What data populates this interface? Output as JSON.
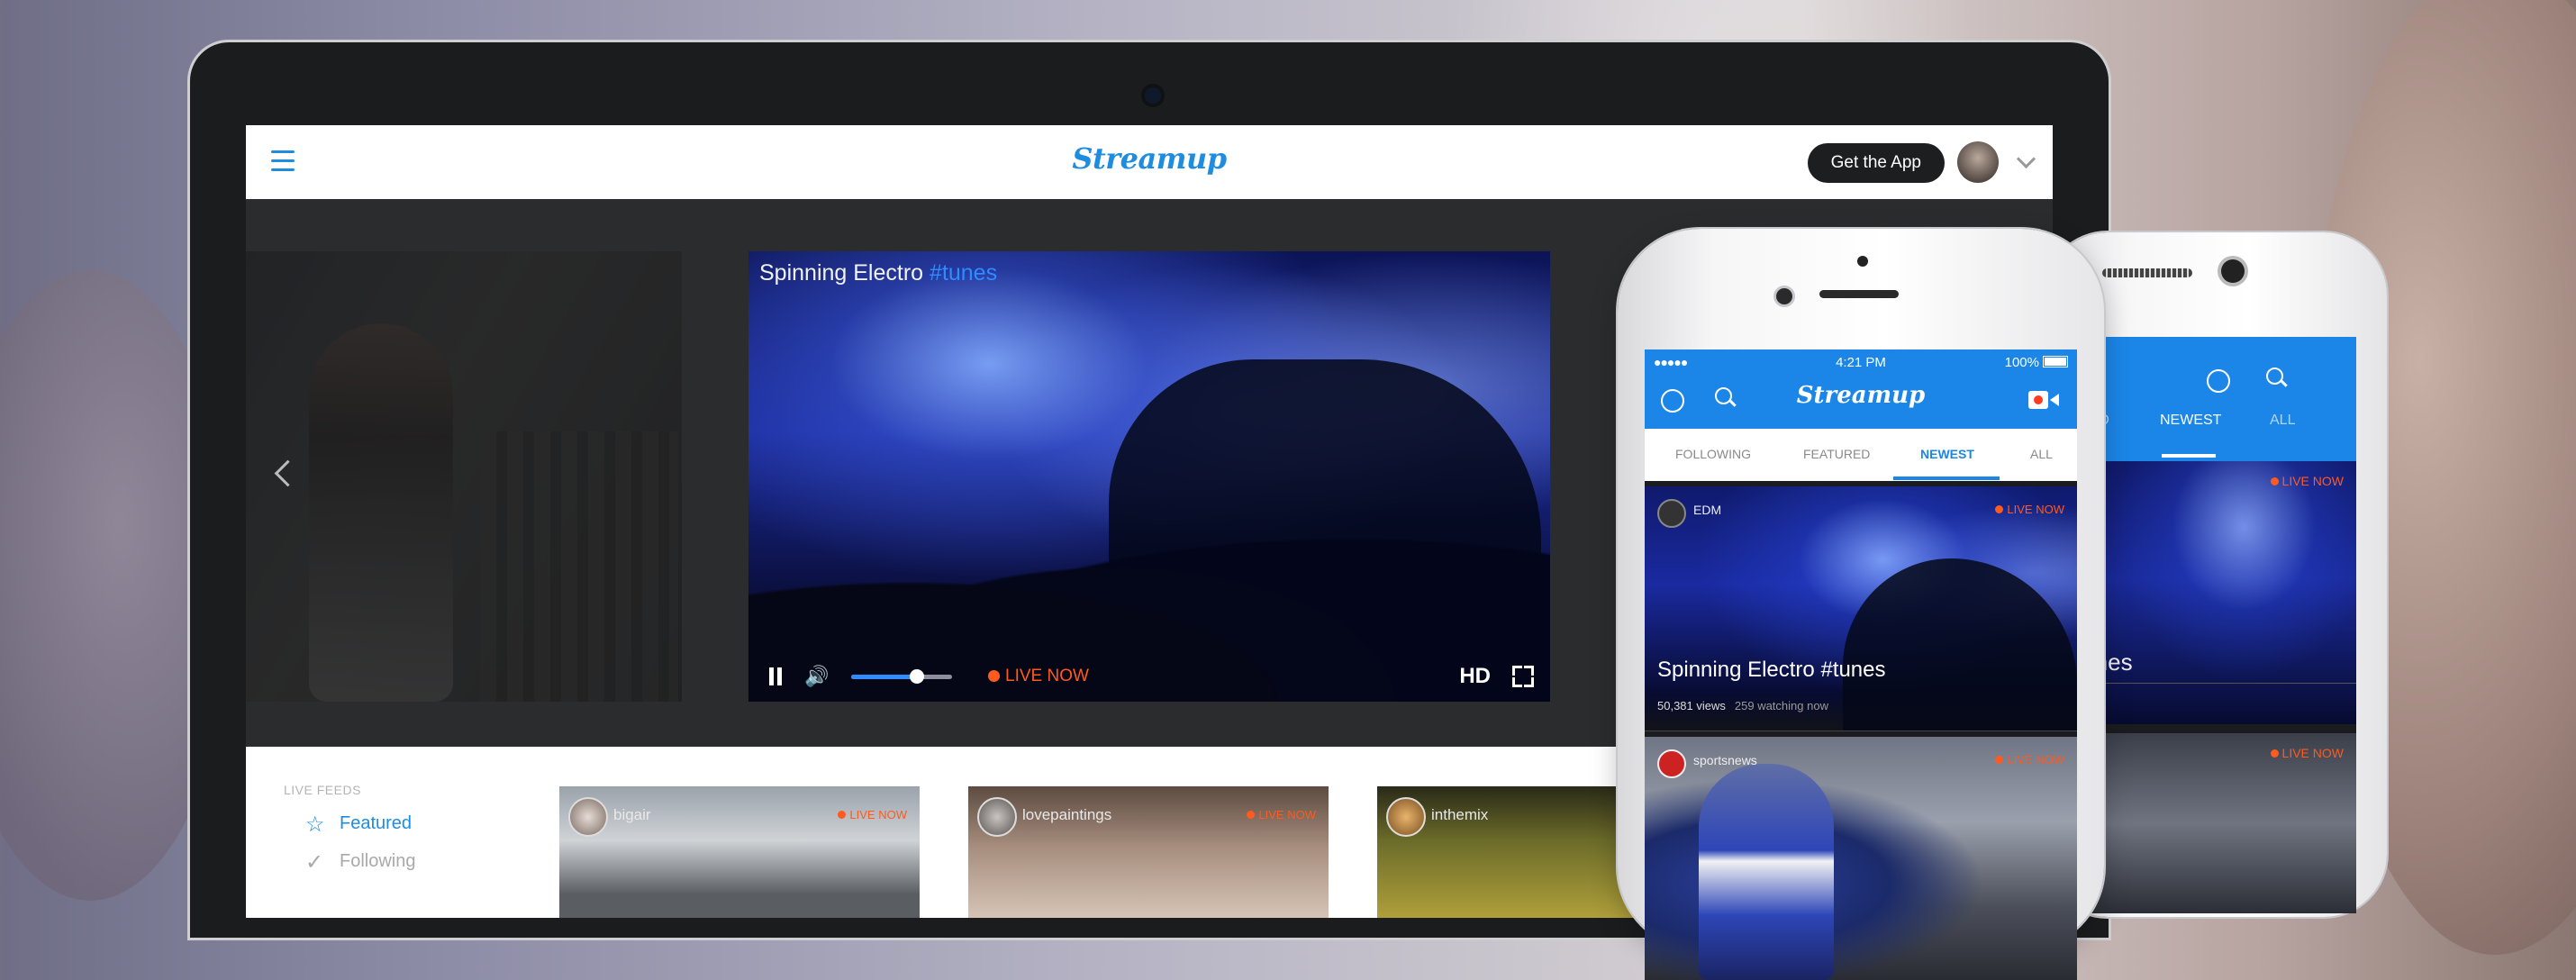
{
  "laptop": {
    "brand": "Streamup",
    "get_app_label": "Get the App",
    "player": {
      "title": "Spinning Electro",
      "hashtag": "#tunes",
      "live_label": "LIVE NOW",
      "hd_label": "HD",
      "volume_level": 0.65
    },
    "live_feeds": {
      "title": "LIVE FEEDS",
      "items": [
        {
          "label": "Featured",
          "icon": "star-icon",
          "color": "#1e8de0"
        },
        {
          "label": "Following",
          "icon": "check-icon",
          "color": "#a9a9a9"
        }
      ]
    },
    "thumbnails": [
      {
        "user": "bigair",
        "live": "LIVE NOW"
      },
      {
        "user": "lovepaintings",
        "live": "LIVE NOW"
      },
      {
        "user": "inthemix",
        "live": ""
      }
    ]
  },
  "phone": {
    "status": {
      "signal": "●●●●●",
      "time": "4:21 PM",
      "battery": "100%"
    },
    "brand": "Streamup",
    "tabs": [
      "FOLLOWING",
      "FEATURED",
      "NEWEST",
      "ALL"
    ],
    "active_tab": "NEWEST",
    "feed": [
      {
        "user": "EDM",
        "live": "LIVE NOW",
        "title": "Spinning Electro #tunes",
        "views": "50,381 views",
        "watching": "259  watching now"
      },
      {
        "user": "sportsnews",
        "live": "LIVE NOW"
      }
    ]
  },
  "phone2": {
    "tabs": [
      "RED",
      "NEWEST",
      "ALL"
    ],
    "live": "LIVE NOW",
    "title": "tunes"
  },
  "colors": {
    "accent": "#1e8de0",
    "live": "#ff5a1f",
    "dark": "#1d1e20"
  }
}
